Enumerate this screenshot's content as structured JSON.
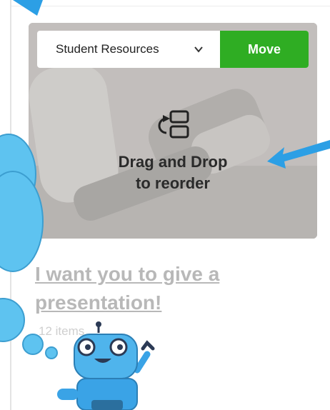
{
  "move_panel": {
    "select_value": "Student Resources",
    "move_label": "Move"
  },
  "drag_hint": {
    "line1": "Drag and Drop",
    "line2": "to reorder"
  },
  "collection": {
    "title": "I want you to give a presentation!",
    "item_count": "12 items"
  },
  "icons": [
    "chevron-down-icon",
    "reorder-icon",
    "arrow-icon",
    "robot-mascot"
  ],
  "colors": {
    "move_button": "#2fad23",
    "arrow": "#2c9fe5",
    "bubble": "#5ec3f0"
  }
}
